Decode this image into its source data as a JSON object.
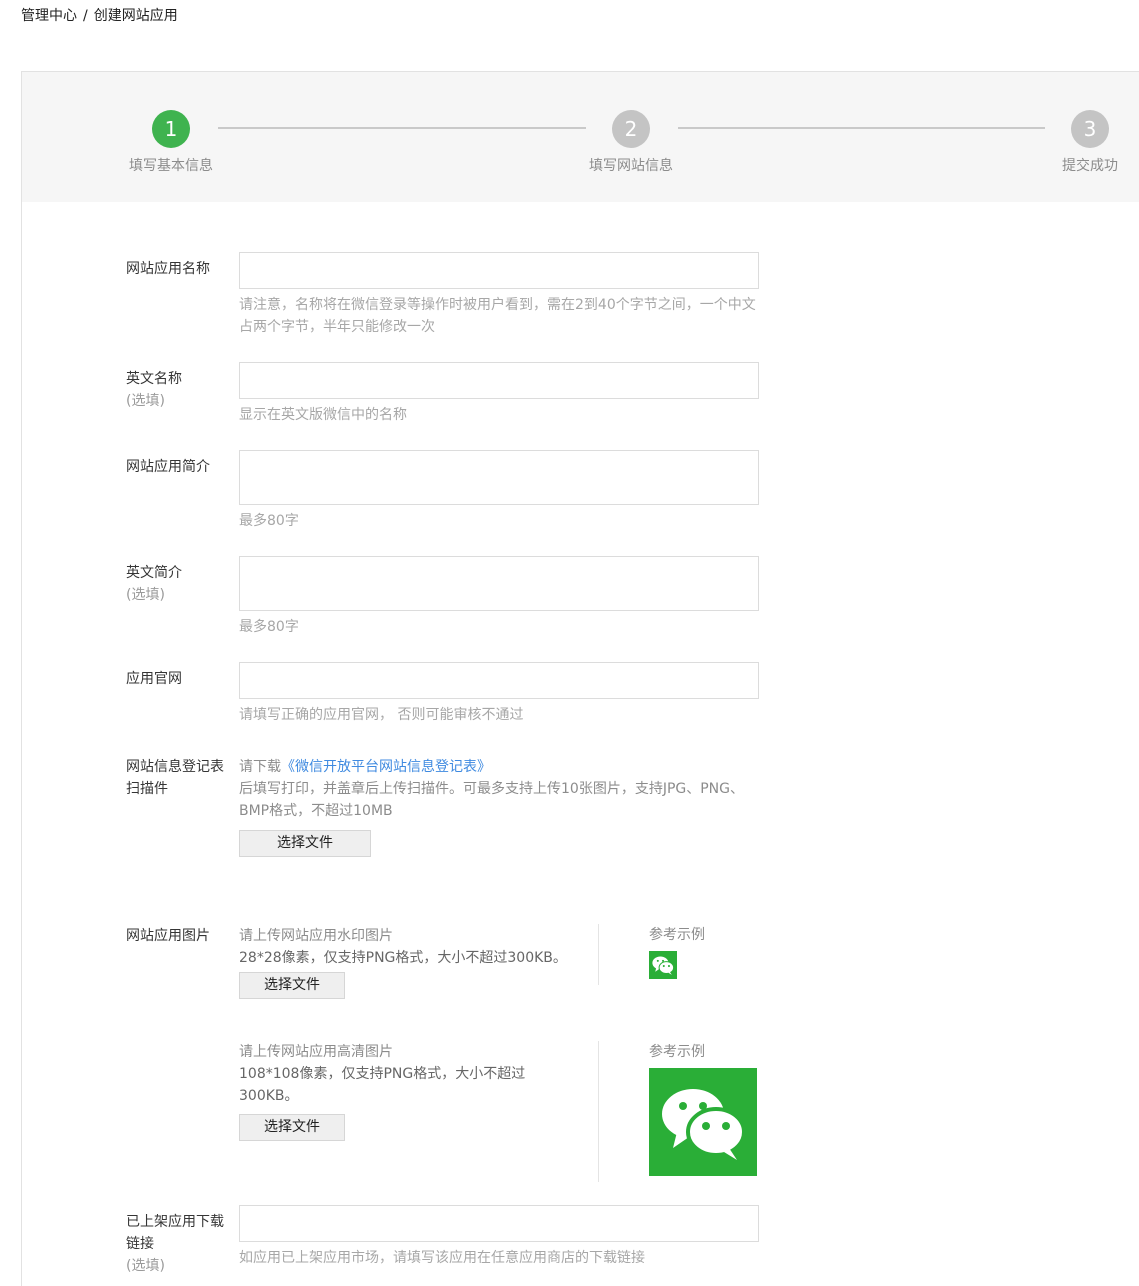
{
  "breadcrumb": {
    "root": "管理中心",
    "separator": "/",
    "current": "创建网站应用"
  },
  "steps": [
    {
      "number": "1",
      "label": "填写基本信息",
      "state": "active"
    },
    {
      "number": "2",
      "label": "填写网站信息",
      "state": "todo"
    },
    {
      "number": "3",
      "label": "提交成功",
      "state": "todo"
    }
  ],
  "form": {
    "app_name": {
      "label": "网站应用名称",
      "value": "",
      "hint": "请注意，名称将在微信登录等操作时被用户看到，需在2到40个字节之间，一个中文占两个字节，半年只能修改一次"
    },
    "english_name": {
      "label": "英文名称",
      "optional": "(选填)",
      "value": "",
      "hint": "显示在英文版微信中的名称"
    },
    "app_intro": {
      "label": "网站应用简介",
      "value": "",
      "hint": "最多80字"
    },
    "english_intro": {
      "label": "英文简介",
      "optional": "(选填)",
      "value": "",
      "hint": "最多80字"
    },
    "official_site": {
      "label": "应用官网",
      "value": "",
      "hint": "请填写正确的应用官网， 否则可能审核不通过"
    },
    "registration": {
      "label": "网站信息登记表扫描件",
      "prefix": "请下载",
      "link": "《微信开放平台网站信息登记表》",
      "desc": "后填写打印，并盖章后上传扫描件。可最多支持上传10张图片，支持JPG、PNG、BMP格式，不超过10MB",
      "button": "选择文件"
    },
    "app_image": {
      "label": "网站应用图片",
      "watermark": {
        "title": "请上传网站应用水印图片",
        "desc": "28*28像素，仅支持PNG格式，大小不超过300KB。",
        "button": "选择文件",
        "ref": "参考示例"
      },
      "hd": {
        "title": "请上传网站应用高清图片",
        "desc": "108*108像素，仅支持PNG格式，大小不超过300KB。",
        "button": "选择文件",
        "ref": "参考示例"
      }
    },
    "download_link": {
      "label": "已上架应用下载链接",
      "optional": "(选填)",
      "value": "",
      "hint": "如应用已上架应用市场，请填写该应用在任意应用商店的下载链接"
    }
  },
  "colors": {
    "accent": "#3fb34f",
    "inactive": "#c4c4c4",
    "link": "#3f8ae0",
    "wechat_green": "#2aae37"
  }
}
